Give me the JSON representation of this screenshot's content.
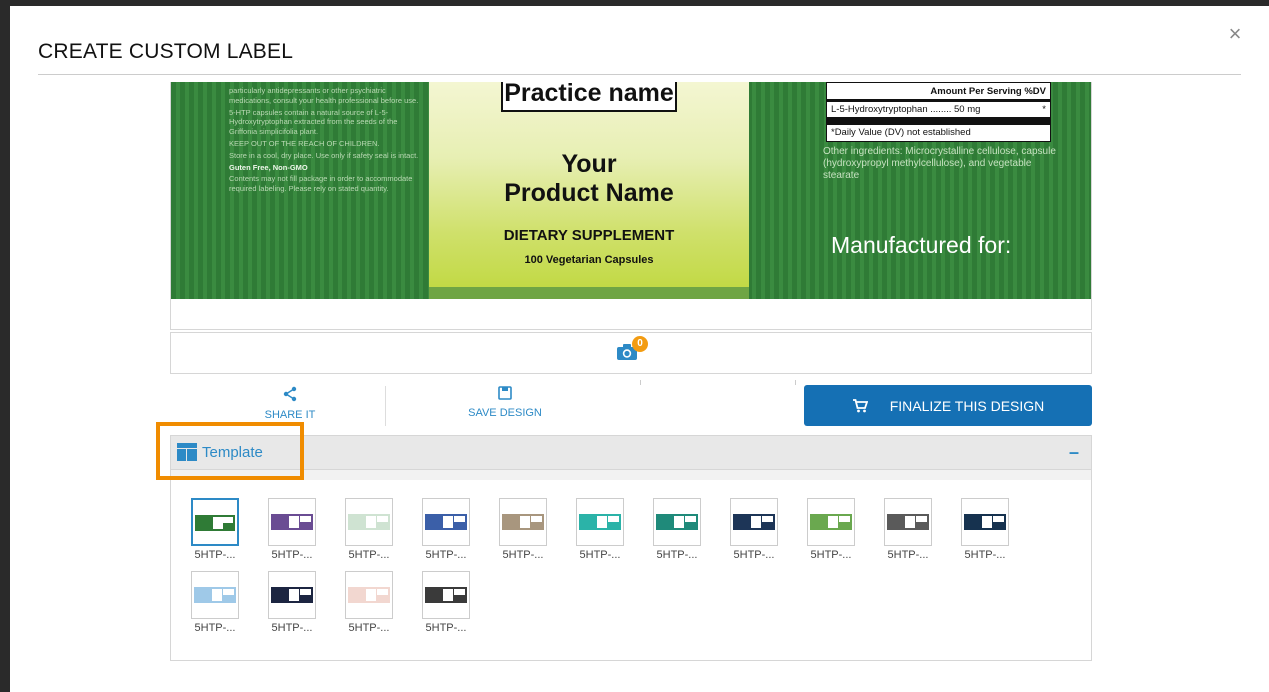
{
  "modal": {
    "title": "CREATE CUSTOM LABEL",
    "close": "×"
  },
  "label": {
    "left_text": [
      {
        "t": "particularly antidepressants or other psychiatric medications, consult your health professional before use.",
        "b": false
      },
      {
        "t": "5-HTP capsules contain a natural source of L-5-Hydroxytryptophan extracted from the seeds of the Griffonia simplicifolia plant.",
        "b": false
      },
      {
        "t": "KEEP OUT OF THE REACH OF CHILDREN.",
        "b": false
      },
      {
        "t": "Store in a cool, dry place. Use only if safety seal is intact.",
        "b": false
      },
      {
        "t": "Guten Free, Non-GMO",
        "b": true
      },
      {
        "t": "Contents may not fill package in order to accommodate required labeling. Please rely on stated quantity.",
        "b": false
      }
    ],
    "practice_name": "Practice name",
    "product_line1": "Your",
    "product_line2": "Product Name",
    "dietary": "DIETARY SUPPLEMENT",
    "capsules": "100 Vegetarian Capsules",
    "facts_header": "Amount Per Serving   %DV",
    "facts_row_name": "L-5-Hydroxytryptophan ........ 50 mg",
    "facts_row_dv": "*",
    "facts_note": "*Daily Value (DV) not established",
    "ingredients": "Other ingredients: Microcrystalline cellulose, capsule (hydroxypropyl methylcellulose), and vegetable stearate",
    "manufactured": "Manufactured for:"
  },
  "camera": {
    "count": "0"
  },
  "actions": {
    "share": "SHARE IT",
    "save": "SAVE DESIGN",
    "finalize": "FINALIZE THIS DESIGN"
  },
  "template_panel": {
    "title": "Template",
    "collapse": "–",
    "thumbnails": [
      {
        "name": "5HTP-...",
        "color": "#2f7b36",
        "selected": true
      },
      {
        "name": "5HTP-...",
        "color": "#6a4c93",
        "selected": false
      },
      {
        "name": "5HTP-...",
        "color": "#cfe3d2",
        "selected": false
      },
      {
        "name": "5HTP-...",
        "color": "#3b5fa8",
        "selected": false
      },
      {
        "name": "5HTP-...",
        "color": "#a8967e",
        "selected": false
      },
      {
        "name": "5HTP-...",
        "color": "#2bb3a8",
        "selected": false
      },
      {
        "name": "5HTP-...",
        "color": "#1f8a7a",
        "selected": false
      },
      {
        "name": "5HTP-...",
        "color": "#1d3557",
        "selected": false
      },
      {
        "name": "5HTP-...",
        "color": "#6aa84f",
        "selected": false
      },
      {
        "name": "5HTP-...",
        "color": "#5a5a5a",
        "selected": false
      },
      {
        "name": "5HTP-...",
        "color": "#16324f",
        "selected": false
      },
      {
        "name": "5HTP-...",
        "color": "#9fc9e8",
        "selected": false
      },
      {
        "name": "5HTP-...",
        "color": "#1c2541",
        "selected": false
      },
      {
        "name": "5HTP-...",
        "color": "#f2d7d0",
        "selected": false
      },
      {
        "name": "5HTP-...",
        "color": "#3a3a3a",
        "selected": false
      }
    ]
  },
  "colors": {
    "accent": "#2d8ac6",
    "button": "#1570b4",
    "highlight": "#f08c00",
    "badge": "#f39c12"
  }
}
